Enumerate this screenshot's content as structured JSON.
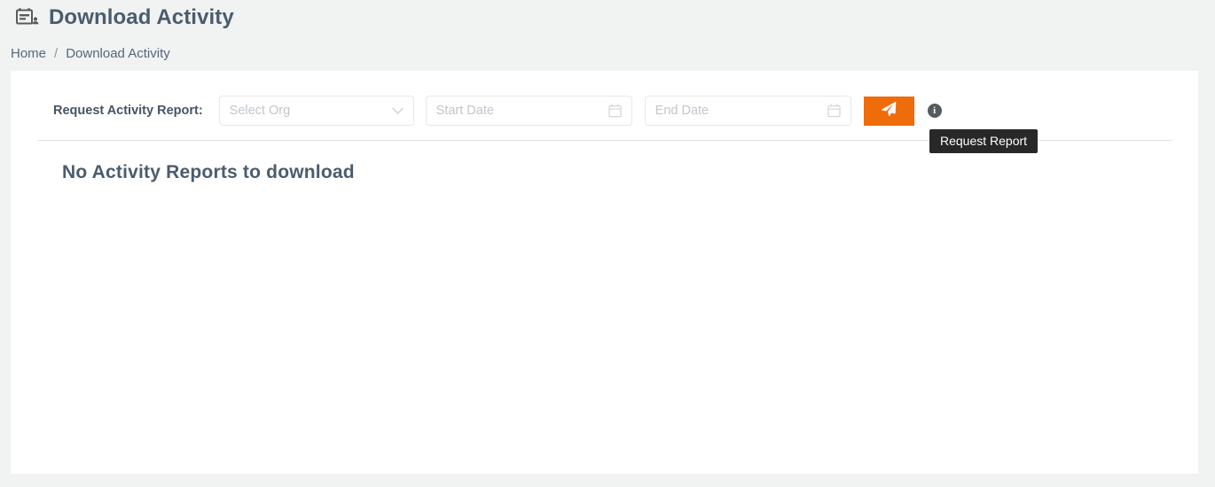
{
  "header": {
    "icon": "id-card-icon",
    "title": "Download Activity"
  },
  "breadcrumb": {
    "home": "Home",
    "separator": "/",
    "current": "Download Activity"
  },
  "filters": {
    "label": "Request Activity Report:",
    "org_select": {
      "placeholder": "Select Org",
      "value": "",
      "icon": "chevron-down-icon"
    },
    "start_date": {
      "placeholder": "Start Date",
      "value": "",
      "icon": "calendar-icon"
    },
    "end_date": {
      "placeholder": "End Date",
      "value": "",
      "icon": "calendar-icon"
    },
    "submit_button": {
      "icon": "paper-plane-icon",
      "label": ""
    },
    "info_button": {
      "icon": "info-circle-icon",
      "glyph": "i"
    }
  },
  "tooltip": {
    "text": "Request Report"
  },
  "content": {
    "empty_message": "No Activity Reports to download"
  },
  "colors": {
    "accent": "#ef6c0b",
    "page_background": "#f1f2f2",
    "card_background": "#ffffff",
    "text": "#4a5c6e",
    "placeholder": "#c0c6cc",
    "tooltip_background": "#282828"
  }
}
